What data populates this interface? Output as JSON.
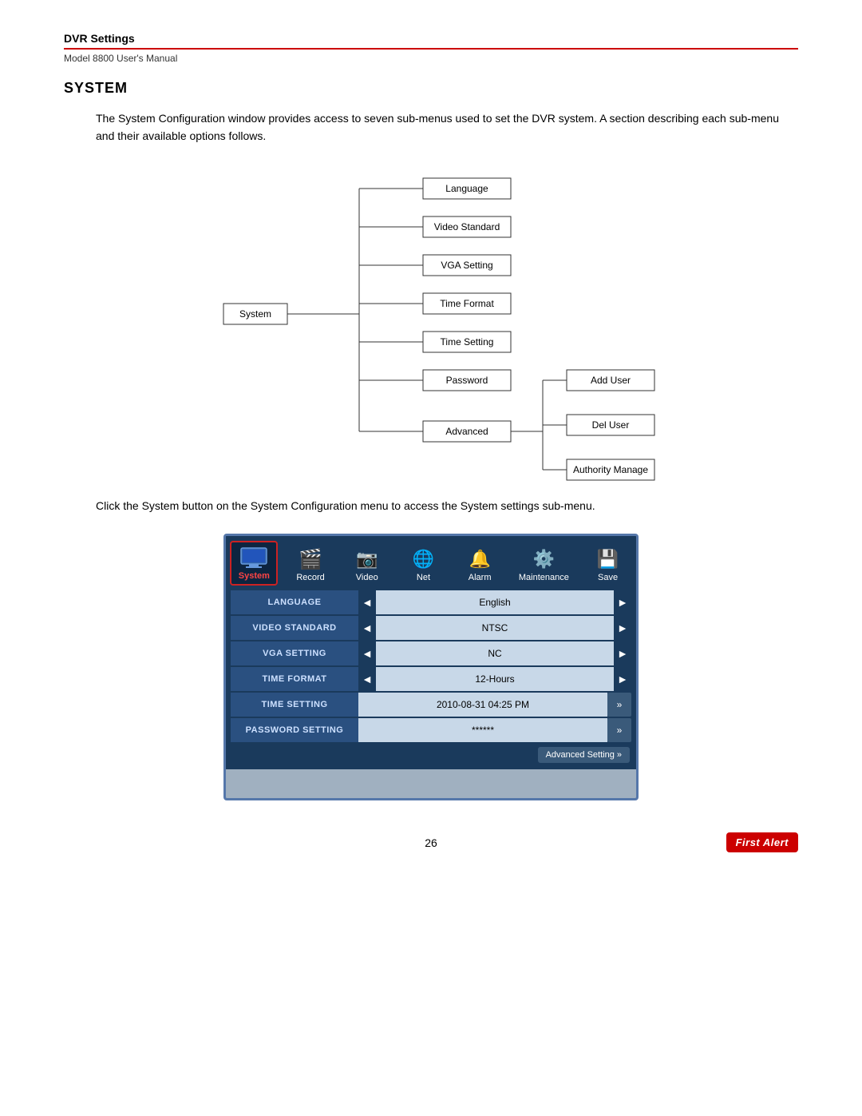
{
  "header": {
    "section": "DVR Settings",
    "manual": "Model 8800 User's Manual"
  },
  "section_title": "System",
  "body_text1": "The System Configuration window provides access to seven sub-menus used to set the DVR system. A section describing each sub-menu and their available options follows.",
  "diagram": {
    "system_label": "System",
    "sub_menus": [
      "Language",
      "Video Standard",
      "VGA Setting",
      "Time Format",
      "Time Setting",
      "Password",
      "Advanced"
    ],
    "advanced_subs": [
      "Add User",
      "Del User",
      "Authority Manage"
    ]
  },
  "body_text2": "Click the System button on the System Configuration menu to access the System settings sub-menu.",
  "dvr_ui": {
    "toolbar": [
      {
        "label": "System",
        "active": true,
        "icon": "🖥"
      },
      {
        "label": "Record",
        "active": false,
        "icon": "🎞"
      },
      {
        "label": "Video",
        "active": false,
        "icon": "📷"
      },
      {
        "label": "Net",
        "active": false,
        "icon": "🌐"
      },
      {
        "label": "Alarm",
        "active": false,
        "icon": "🔔"
      },
      {
        "label": "Maintenance",
        "active": false,
        "icon": "⚙"
      },
      {
        "label": "Save",
        "active": false,
        "icon": "💾"
      }
    ],
    "menu_rows": [
      {
        "label": "LANGUAGE",
        "value": "English",
        "arrow": "single"
      },
      {
        "label": "VIDEO STANDARD",
        "value": "NTSC",
        "arrow": "single"
      },
      {
        "label": "VGA SETTING",
        "value": "NC",
        "arrow": "single"
      },
      {
        "label": "TIME FORMAT",
        "value": "12-Hours",
        "arrow": "single"
      },
      {
        "label": "TIME SETTING",
        "value": "2010-08-31 04:25 PM",
        "arrow": "double"
      },
      {
        "label": "PASSWORD SETTING",
        "value": "******",
        "arrow": "double"
      }
    ],
    "advanced_button": "Advanced Setting »"
  },
  "footer": {
    "page_number": "26",
    "brand": "First Alert"
  }
}
